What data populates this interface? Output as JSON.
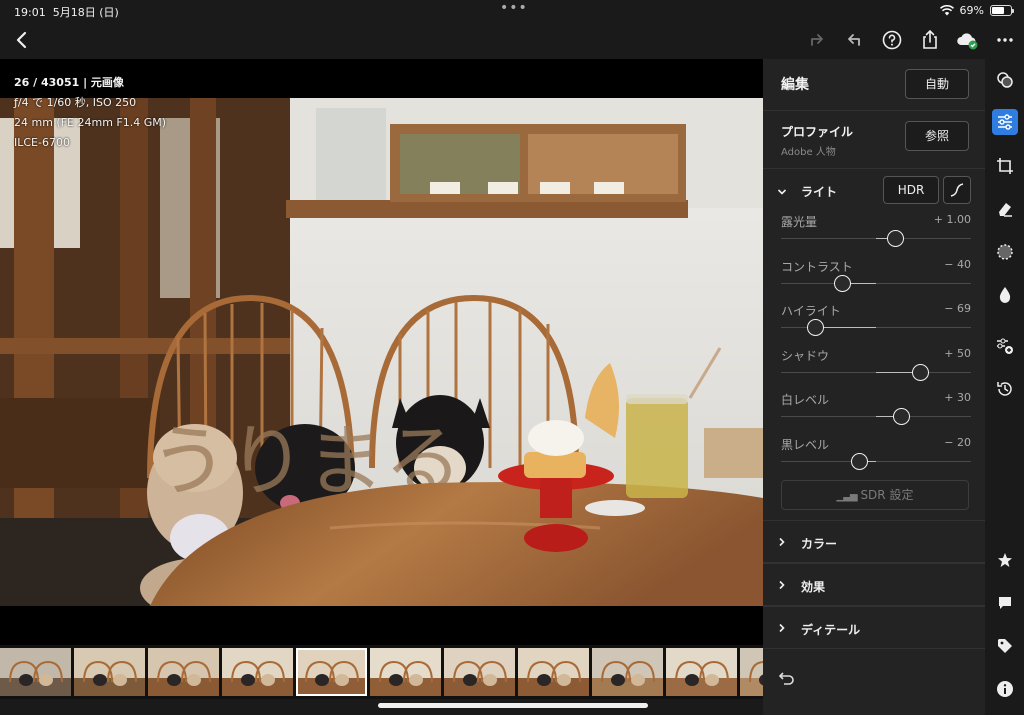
{
  "status": {
    "time": "19:01",
    "date": "5月18日 (日)",
    "battery": "69%",
    "battery_level": 0.69
  },
  "photo_meta": {
    "index": "26 / 43051 | 元画像",
    "exposure": "ƒ/4 で 1/60 秒, ISO 250",
    "lens": "24 mm (FE 24mm F1.4 GM)",
    "camera": "ILCE-6700"
  },
  "panel": {
    "title": "編集",
    "auto_label": "自動",
    "profile_title": "プロファイル",
    "profile_value": "Adobe 人物",
    "browse_label": "参照",
    "light_label": "ライト",
    "hdr_label": "HDR",
    "sliders": [
      {
        "label": "露光量",
        "value": "+ 1.00",
        "pos": 0.6
      },
      {
        "label": "コントラスト",
        "value": "− 40",
        "pos": 0.32
      },
      {
        "label": "ハイライト",
        "value": "− 69",
        "pos": 0.18
      },
      {
        "label": "シャドウ",
        "value": "+ 50",
        "pos": 0.73
      },
      {
        "label": "白レベル",
        "value": "+ 30",
        "pos": 0.63
      },
      {
        "label": "黒レベル",
        "value": "− 20",
        "pos": 0.41
      }
    ],
    "sdr_label": "SDR 設定",
    "sections": [
      "カラー",
      "効果",
      "ディテール"
    ]
  },
  "watermark": "うりまる",
  "colors": {
    "accent": "#2f7de1",
    "panel_bg": "#232323"
  }
}
